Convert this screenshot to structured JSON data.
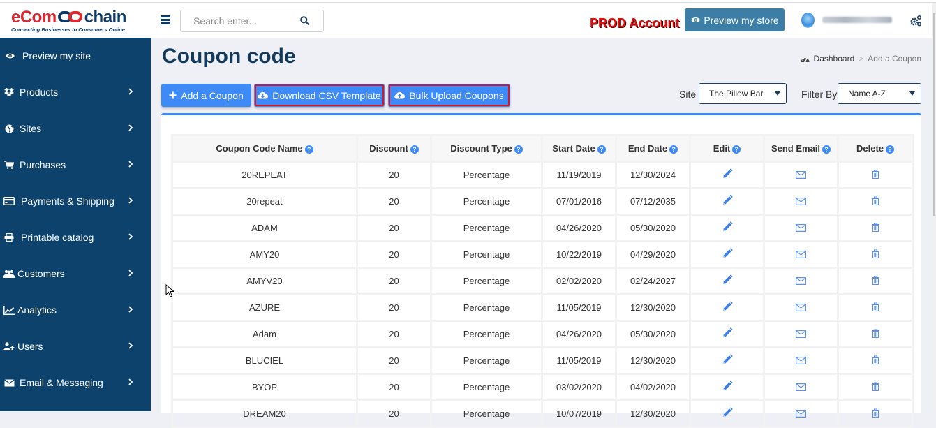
{
  "header": {
    "logo": {
      "part1": "eCom",
      "part2": "chain",
      "tagline": "Connecting Businesses to Consumers Online"
    },
    "menu_icon": "hamburger-icon",
    "search": {
      "placeholder": "Search enter...",
      "value": "",
      "icon": "search-icon"
    },
    "account_label": "PROD Account",
    "preview_store_label": "Preview my store",
    "user_name": "",
    "settings_icon": "gears-icon"
  },
  "sidebar": {
    "items": [
      {
        "label": "Preview my site",
        "icon": "eye-icon",
        "has_submenu": false
      },
      {
        "label": "Products",
        "icon": "dropbox-icon",
        "has_submenu": true
      },
      {
        "label": "Sites",
        "icon": "globe-icon",
        "has_submenu": true
      },
      {
        "label": "Purchases",
        "icon": "cart-icon",
        "has_submenu": true
      },
      {
        "label": "Payments & Shipping",
        "icon": "credit-card-icon",
        "has_submenu": true
      },
      {
        "label": "Printable catalog",
        "icon": "print-icon",
        "has_submenu": true
      },
      {
        "label": "Customers",
        "icon": "users-icon",
        "has_submenu": true
      },
      {
        "label": "Analytics",
        "icon": "line-chart-icon",
        "has_submenu": true
      },
      {
        "label": "Users",
        "icon": "user-plus-icon",
        "has_submenu": true
      },
      {
        "label": "Email & Messaging",
        "icon": "envelope-icon",
        "has_submenu": true
      }
    ]
  },
  "page": {
    "title": "Coupon code",
    "breadcrumb": {
      "home": "Dashboard",
      "separator": ">",
      "current": "Add a Coupon"
    },
    "buttons": {
      "add": "Add a Coupon",
      "download": "Download CSV Template",
      "bulk_upload": "Bulk Upload Coupons"
    },
    "site_filter": {
      "label": "Site",
      "selected": "The Pillow Bar"
    },
    "sort_filter": {
      "label": "Filter By",
      "selected": "Name A-Z"
    }
  },
  "table": {
    "columns": [
      "Coupon Code Name",
      "Discount",
      "Discount Type",
      "Start Date",
      "End Date",
      "Edit",
      "Send Email",
      "Delete"
    ],
    "rows": [
      {
        "name": "20REPEAT",
        "discount": "20",
        "type": "Percentage",
        "start": "11/19/2019",
        "end": "12/30/2024"
      },
      {
        "name": "20repeat",
        "discount": "20",
        "type": "Percentage",
        "start": "07/01/2016",
        "end": "07/12/2035"
      },
      {
        "name": "ADAM",
        "discount": "20",
        "type": "Percentage",
        "start": "04/26/2020",
        "end": "05/30/2020"
      },
      {
        "name": "AMY20",
        "discount": "20",
        "type": "Percentage",
        "start": "10/22/2019",
        "end": "04/29/2020"
      },
      {
        "name": "AMYV20",
        "discount": "20",
        "type": "Percentage",
        "start": "02/02/2020",
        "end": "02/24/2027"
      },
      {
        "name": "AZURE",
        "discount": "20",
        "type": "Percentage",
        "start": "11/05/2019",
        "end": "12/30/2020"
      },
      {
        "name": "Adam",
        "discount": "20",
        "type": "Percentage",
        "start": "04/26/2020",
        "end": "05/30/2020"
      },
      {
        "name": "BLUCIEL",
        "discount": "20",
        "type": "Percentage",
        "start": "11/05/2019",
        "end": "12/30/2020"
      },
      {
        "name": "BYOP",
        "discount": "20",
        "type": "Percentage",
        "start": "03/02/2020",
        "end": "04/02/2020"
      },
      {
        "name": "DREAM20",
        "discount": "20",
        "type": "Percentage",
        "start": "10/07/2019",
        "end": "12/30/2020"
      }
    ]
  },
  "colors": {
    "sidebar_bg": "#0c426b",
    "accent": "#3e8af7",
    "preview_button": "#3d7ea6",
    "prod_label": "#e40b0b",
    "highlight_outline": "#d4152c",
    "title": "#133a5c"
  }
}
